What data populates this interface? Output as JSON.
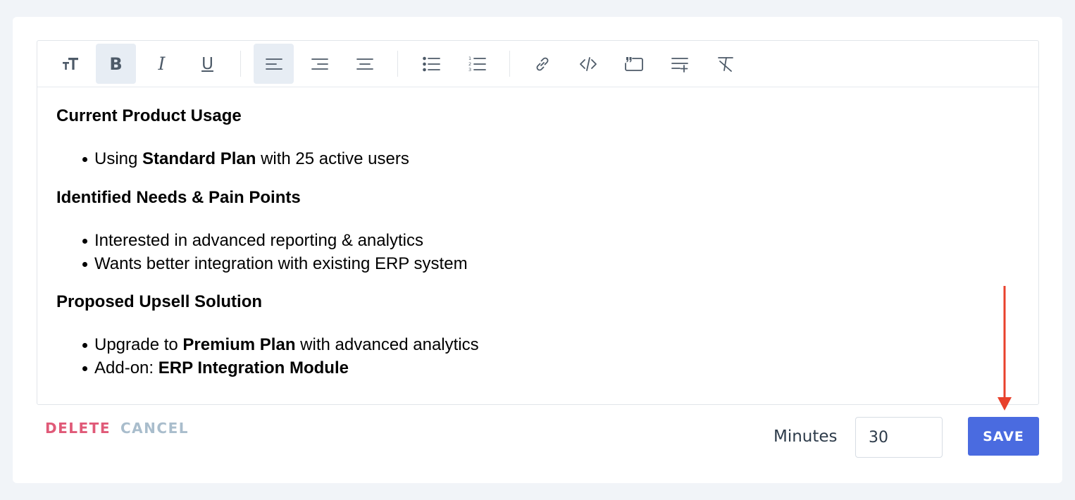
{
  "toolbar": {
    "buttons": [
      {
        "name": "text-size-icon",
        "active": false
      },
      {
        "name": "bold-icon",
        "active": true,
        "label": "B"
      },
      {
        "name": "italic-icon",
        "active": false,
        "label": "I"
      },
      {
        "name": "underline-icon",
        "active": false,
        "label": "U"
      },
      {
        "name": "align-left-icon",
        "active": true
      },
      {
        "name": "align-right-icon",
        "active": false
      },
      {
        "name": "align-center-icon",
        "active": false
      },
      {
        "name": "bullet-list-icon",
        "active": false
      },
      {
        "name": "numbered-list-icon",
        "active": false,
        "numbers": [
          "1",
          "2",
          "3"
        ]
      },
      {
        "name": "link-icon",
        "active": false
      },
      {
        "name": "code-icon",
        "active": false
      },
      {
        "name": "quote-icon",
        "active": false
      },
      {
        "name": "insert-line-icon",
        "active": false
      },
      {
        "name": "clear-format-icon",
        "active": false
      }
    ]
  },
  "content": {
    "sections": [
      {
        "heading": "Current Product Usage",
        "items": [
          {
            "pre": "Using ",
            "bold": "Standard Plan",
            "post": " with 25 active users"
          }
        ]
      },
      {
        "heading": "Identified Needs & Pain Points",
        "items": [
          {
            "pre": "Interested in advanced reporting & analytics",
            "bold": "",
            "post": ""
          },
          {
            "pre": "Wants better integration with existing ERP system",
            "bold": "",
            "post": ""
          }
        ]
      },
      {
        "heading": "Proposed Upsell Solution",
        "items": [
          {
            "pre": "Upgrade to ",
            "bold": "Premium Plan",
            "post": " with advanced analytics"
          },
          {
            "pre": "Add-on: ",
            "bold": "ERP Integration Module",
            "post": ""
          }
        ]
      }
    ]
  },
  "footer": {
    "delete_label": "DELETE",
    "cancel_label": "CANCEL",
    "minutes_label": "Minutes",
    "minutes_value": "30",
    "save_label": "SAVE"
  },
  "colors": {
    "accent": "#4a6be0",
    "delete": "#e05a78",
    "cancel": "#a9bdcc",
    "annotation_arrow": "#e8412c"
  }
}
